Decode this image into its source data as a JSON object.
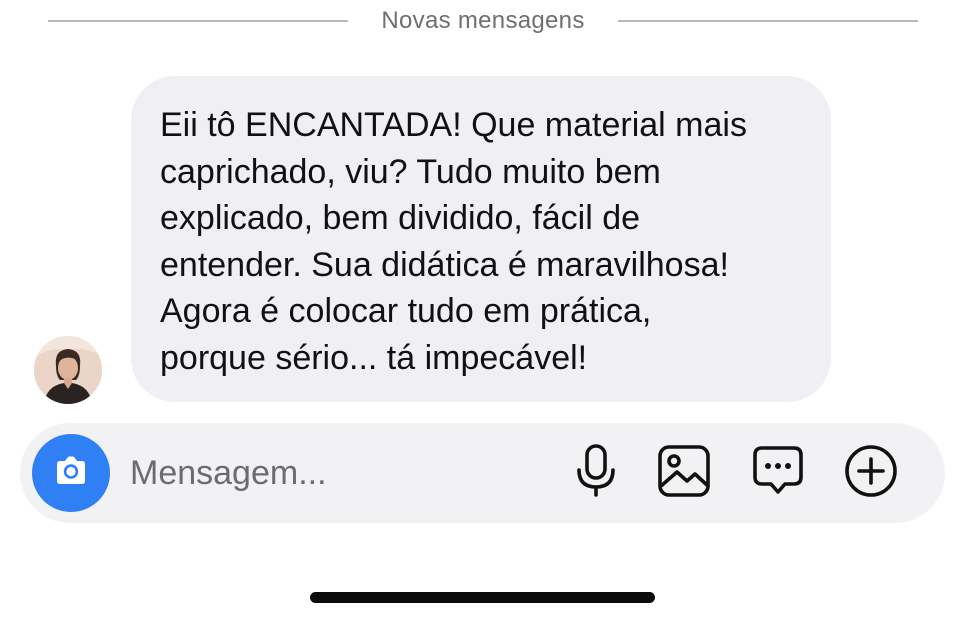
{
  "divider": {
    "label": "Novas mensagens"
  },
  "message": {
    "text": "Eii tô ENCANTADA! Que material mais\ncaprichado, viu? Tudo muito bem\nexplicado, bem dividido, fácil de\nentender. Sua didática é maravilhosa!\nAgora é colocar tudo em prática,\nporque sério... tá impecável!"
  },
  "composer": {
    "placeholder": "Mensagem...",
    "value": ""
  },
  "icons": {
    "camera": "camera-icon",
    "microphone": "microphone-icon",
    "gallery": "image-gallery-icon",
    "sticker": "sticker-chat-icon",
    "plus": "plus-circle-icon"
  },
  "colors": {
    "accent": "#2f7ff5",
    "bubble": "#efeff4",
    "composer": "#f2f2f4",
    "divider_text": "#6e6e73"
  }
}
